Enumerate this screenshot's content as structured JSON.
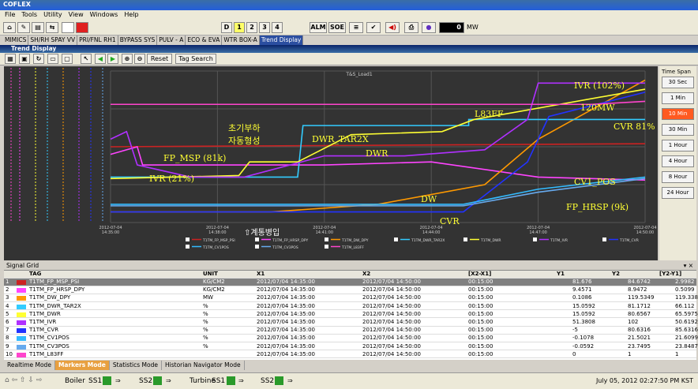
{
  "window": {
    "title": "COFLEX"
  },
  "menu": [
    "File",
    "Tools",
    "Utility",
    "View",
    "Windows",
    "Help"
  ],
  "toolbar": {
    "d": "D",
    "b1": "1",
    "b2": "2",
    "b3": "3",
    "b4": "4",
    "alm": "ALM",
    "soe": "SOE",
    "mw_value": "0",
    "mw_unit": "MW"
  },
  "nav_tabs": [
    {
      "label": "MIMICS",
      "active": false
    },
    {
      "label": "SH/RH SPAY VV",
      "active": false
    },
    {
      "label": "PRI/FNL RH1",
      "active": false
    },
    {
      "label": "BYPASS SYS",
      "active": false
    },
    {
      "label": "PULV - A",
      "active": false
    },
    {
      "label": "ECO & EVA",
      "active": false
    },
    {
      "label": "WTR BOX-A",
      "active": false
    },
    {
      "label": "Trend Display",
      "active": true
    }
  ],
  "trend": {
    "title": "Trend Display",
    "reset": "Reset",
    "tag_search": "Tag Search",
    "chart_title": "T&S_Load1"
  },
  "time_span": {
    "title": "Time Span",
    "options": [
      "30 Sec",
      "1 Min",
      "10 Min",
      "30 Min",
      "1 Hour",
      "4 Hour",
      "8 Hour",
      "24 Hour"
    ],
    "selected": "10 Min"
  },
  "chart_data": {
    "type": "line",
    "title": "T&S_Load1",
    "x_ticks": [
      "2012-07-04\n14:35:00",
      "2012-07-04\n14:38:00",
      "2012-07-04\n14:41:00",
      "2012-07-04\n14:44:00",
      "2012-07-04\n14:47:00",
      "2012-07-04\n14:50:00"
    ],
    "x_start": "2012-07-04 14:35:00",
    "x_end": "2012-07-04 14:50:00",
    "series": [
      {
        "name": "T1TM_FP_MSP_PSI",
        "color": "#cc2222"
      },
      {
        "name": "T1TM_FP_HRSP_DPY",
        "color": "#ff44ff"
      },
      {
        "name": "T1TM_DW_DPY",
        "color": "#ff9900"
      },
      {
        "name": "T1TM_DWR_TAR2X",
        "color": "#33ccff"
      },
      {
        "name": "T1TM_DWR",
        "color": "#ffff33"
      },
      {
        "name": "T1TM_IVR",
        "color": "#b030ff"
      },
      {
        "name": "T1TM_CVR",
        "color": "#2233ff"
      },
      {
        "name": "T1TM_CV1POS",
        "color": "#33bbff"
      },
      {
        "name": "T1TM_CV3POS",
        "color": "#66aaee"
      },
      {
        "name": "T1TM_L83FF",
        "color": "#ff44cc"
      }
    ],
    "annotations": [
      "IVR (102%)",
      "120MW",
      "CVR 81%",
      "L83FF",
      "초기부하",
      "자동형성",
      "DWR_TAR2X",
      "FP_MSP (81k)",
      "DWR",
      "IVR (21%)",
      "DW",
      "CVR",
      "CV1_POS",
      "FP_HRSP (9k)",
      "계통병입"
    ]
  },
  "grid": {
    "header": "Signal Grid",
    "columns": [
      "TAG",
      "UNIT",
      "X1",
      "X2",
      "[X2-X1]",
      "Y1",
      "Y2",
      "[Y2-Y1]"
    ],
    "rows": [
      {
        "n": "1",
        "color": "#cc2222",
        "tag": "T1TM_FP_MSP_PSI",
        "unit": "KG/CM2",
        "x1": "2012/07/04 14:35:00",
        "x2": "2012/07/04 14:50:00",
        "dx": "00:15:00",
        "y1": "81.676",
        "y2": "84.6742",
        "dy": "2.9982",
        "sel": true
      },
      {
        "n": "2",
        "color": "#ff44ff",
        "tag": "T1TM_FP_HRSP_DPY",
        "unit": "KG/CM2",
        "x1": "2012/07/04 14:35:00",
        "x2": "2012/07/04 14:50:00",
        "dx": "00:15:00",
        "y1": "9.4571",
        "y2": "8.9472",
        "dy": "0.5099"
      },
      {
        "n": "3",
        "color": "#ff9900",
        "tag": "T1TM_DW_DPY",
        "unit": "MW",
        "x1": "2012/07/04 14:35:00",
        "x2": "2012/07/04 14:50:00",
        "dx": "00:15:00",
        "y1": "0.1086",
        "y2": "119.5349",
        "dy": "119.3383"
      },
      {
        "n": "4",
        "color": "#33ccff",
        "tag": "T1TM_DWR_TAR2X",
        "unit": "%",
        "x1": "2012/07/04 14:35:00",
        "x2": "2012/07/04 14:50:00",
        "dx": "00:15:00",
        "y1": "15.0592",
        "y2": "81.1712",
        "dy": "66.112"
      },
      {
        "n": "5",
        "color": "#ffff33",
        "tag": "T1TM_DWR",
        "unit": "%",
        "x1": "2012/07/04 14:35:00",
        "x2": "2012/07/04 14:50:00",
        "dx": "00:15:00",
        "y1": "15.0592",
        "y2": "80.6567",
        "dy": "65.5975"
      },
      {
        "n": "6",
        "color": "#b030ff",
        "tag": "T1TM_IVR",
        "unit": "%",
        "x1": "2012/07/04 14:35:00",
        "x2": "2012/07/04 14:50:00",
        "dx": "00:15:00",
        "y1": "51.3808",
        "y2": "102",
        "dy": "50.6192"
      },
      {
        "n": "7",
        "color": "#2233ff",
        "tag": "T1TM_CVR",
        "unit": "%",
        "x1": "2012/07/04 14:35:00",
        "x2": "2012/07/04 14:50:00",
        "dx": "00:15:00",
        "y1": "-5",
        "y2": "80.6316",
        "dy": "85.6316"
      },
      {
        "n": "8",
        "color": "#33bbff",
        "tag": "T1TM_CV1POS",
        "unit": "%",
        "x1": "2012/07/04 14:35:00",
        "x2": "2012/07/04 14:50:00",
        "dx": "00:15:00",
        "y1": "-0.1078",
        "y2": "21.5021",
        "dy": "21.6099"
      },
      {
        "n": "9",
        "color": "#66aaee",
        "tag": "T1TM_CV3POS",
        "unit": "%",
        "x1": "2012/07/04 14:35:00",
        "x2": "2012/07/04 14:50:00",
        "dx": "00:15:00",
        "y1": "-0.0592",
        "y2": "23.7495",
        "dy": "23.8487"
      },
      {
        "n": "10",
        "color": "#ff44cc",
        "tag": "T1TM_L83FF",
        "unit": "",
        "x1": "2012/07/04 14:35:00",
        "x2": "2012/07/04 14:50:00",
        "dx": "00:15:00",
        "y1": "0",
        "y2": "1",
        "dy": "1"
      }
    ]
  },
  "mode_tabs": [
    {
      "label": "Realtime Mode",
      "active": false
    },
    {
      "label": "Markers Mode",
      "active": true
    },
    {
      "label": "Statistics Mode",
      "active": false
    },
    {
      "label": "Historian Navigator Mode",
      "active": false
    }
  ],
  "status": {
    "boiler": "Boiler",
    "ss1": "SS1",
    "ss2": "SS2",
    "turbine": "Turbine",
    "ss1b": "SS1",
    "ss2b": "SS2",
    "datetime": "July 05, 2012 02:27:50 PM KST"
  }
}
